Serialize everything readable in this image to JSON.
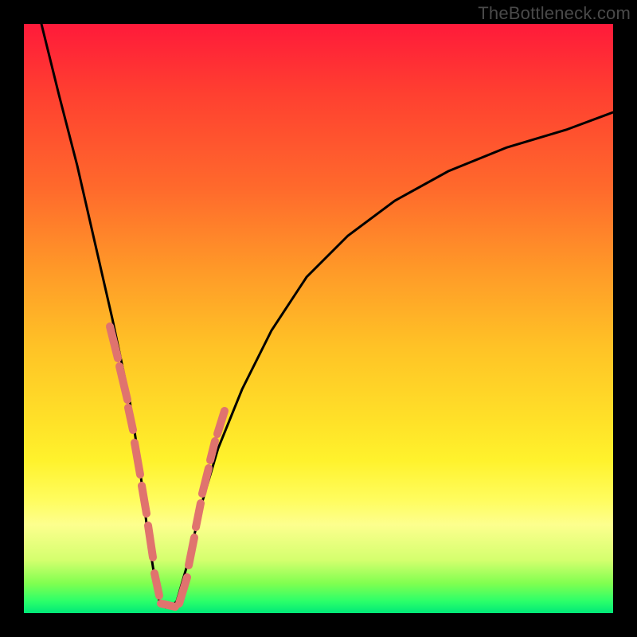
{
  "watermark": "TheBottleneck.com",
  "colors": {
    "frame": "#000000",
    "gradient_top": "#ff1a3a",
    "gradient_mid": "#ffe028",
    "gradient_bottom": "#00e878",
    "curve": "#000000",
    "markers": "#e0736e"
  },
  "chart_data": {
    "type": "line",
    "title": "",
    "xlabel": "",
    "ylabel": "",
    "xlim": [
      0,
      100
    ],
    "ylim": [
      0,
      100
    ],
    "series": [
      {
        "name": "bottleneck-curve",
        "x": [
          3,
          6,
          9,
          12,
          15,
          18,
          19,
          20,
          21,
          22,
          23,
          24,
          25,
          26,
          28,
          30,
          33,
          37,
          42,
          48,
          55,
          63,
          72,
          82,
          92,
          100
        ],
        "y": [
          100,
          88,
          76,
          63,
          50,
          36,
          29,
          22,
          14,
          7,
          2,
          1,
          1,
          2,
          9,
          18,
          28,
          38,
          48,
          57,
          64,
          70,
          75,
          79,
          82,
          85
        ]
      }
    ],
    "annotations": [
      {
        "name": "marker-cluster-left",
        "x_range": [
          14,
          19
        ],
        "y_range": [
          20,
          45
        ]
      },
      {
        "name": "marker-cluster-bottom",
        "x_range": [
          20,
          25
        ],
        "y_range": [
          0,
          6
        ]
      },
      {
        "name": "marker-cluster-right",
        "x_range": [
          26,
          31
        ],
        "y_range": [
          8,
          30
        ]
      }
    ]
  }
}
